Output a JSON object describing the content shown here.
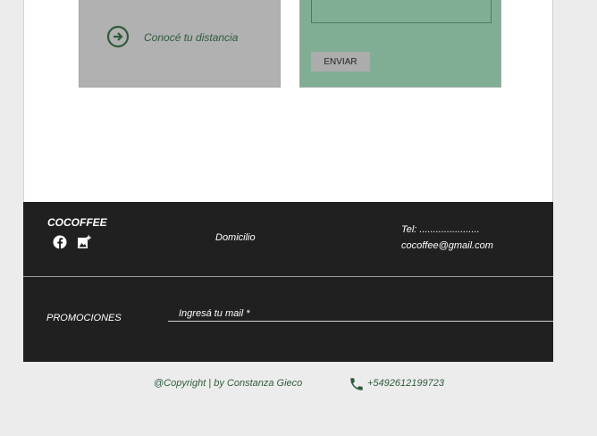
{
  "distance_card": {
    "label": "Conocé tu distancia",
    "icon": "arrow-right-circle-icon"
  },
  "contact_form": {
    "send_label": "ENVIAR"
  },
  "footer": {
    "brand": "COCOFFEE",
    "social_icons": [
      "facebook-icon",
      "image-add-icon"
    ],
    "address_label": "Domicilio",
    "tel_label": "Tel: ......................",
    "email": "cocoffee@gmail.com"
  },
  "promotions": {
    "label": "PROMOCIONES",
    "email_placeholder": "Ingresá tu mail *"
  },
  "bottom_bar": {
    "copyright": "@Copyright | by Constanza Gieco",
    "phone": "+5492612199723",
    "phone_icon": "phone-icon"
  },
  "colors": {
    "dark_green": "#2f5a3c",
    "sage_green": "#82ad95",
    "footer_dark": "#202020",
    "card_grey": "#b1b1b1"
  }
}
